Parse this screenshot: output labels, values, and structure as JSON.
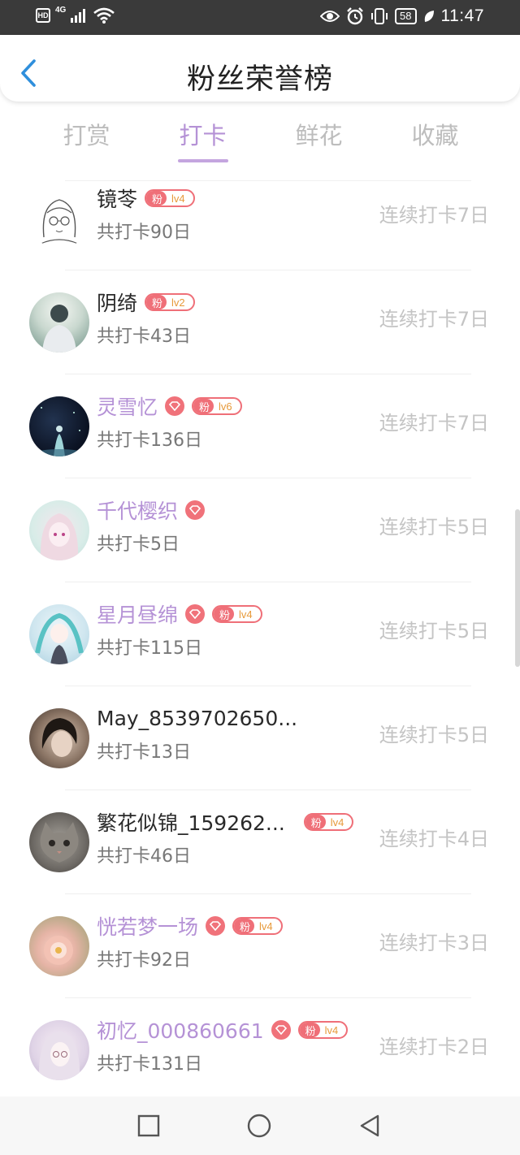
{
  "status_bar": {
    "hd_label": "HD",
    "network": "4G",
    "battery": "58",
    "time": "11:47",
    "icons": [
      "signal-icon",
      "wifi-icon",
      "eye-icon",
      "alarm-icon",
      "vibrate-icon",
      "battery-icon",
      "leaf-icon"
    ]
  },
  "header": {
    "title": "粉丝荣誉榜",
    "back_icon": "chevron-left-icon"
  },
  "tabs": [
    {
      "label": "打赏",
      "active": false
    },
    {
      "label": "打卡",
      "active": true
    },
    {
      "label": "鲜花",
      "active": false
    },
    {
      "label": "收藏",
      "active": false
    }
  ],
  "colors": {
    "accent": "#b592d6",
    "badge": "#ef6f78",
    "level_text": "#e79a3a",
    "muted": "#c4c4c4"
  },
  "fan_badge_label": "粉",
  "entries": [
    {
      "name": "镜苓",
      "vip": false,
      "gem": false,
      "level": "lv4",
      "total": "共打卡90日",
      "streak": "连续打卡7日"
    },
    {
      "name": "阴绮",
      "vip": false,
      "gem": false,
      "level": "lv2",
      "total": "共打卡43日",
      "streak": "连续打卡7日"
    },
    {
      "name": "灵雪忆",
      "vip": true,
      "gem": true,
      "level": "lv6",
      "total": "共打卡136日",
      "streak": "连续打卡7日"
    },
    {
      "name": "千代樱织",
      "vip": true,
      "gem": true,
      "level": null,
      "total": "共打卡5日",
      "streak": "连续打卡5日"
    },
    {
      "name": "星月昼绵",
      "vip": true,
      "gem": true,
      "level": "lv4",
      "total": "共打卡115日",
      "streak": "连续打卡5日"
    },
    {
      "name": "May_8539702650...",
      "vip": false,
      "gem": false,
      "level": null,
      "total": "共打卡13日",
      "streak": "连续打卡5日"
    },
    {
      "name": "繁花似锦_159262...",
      "vip": false,
      "gem": false,
      "level": "lv4",
      "total": "共打卡46日",
      "streak": "连续打卡4日"
    },
    {
      "name": "恍若梦一场",
      "vip": true,
      "gem": true,
      "level": "lv4",
      "total": "共打卡92日",
      "streak": "连续打卡3日"
    },
    {
      "name": "初忆_000860661",
      "vip": true,
      "gem": true,
      "level": "lv4",
      "total": "共打卡131日",
      "streak": "连续打卡2日"
    }
  ],
  "nav_bar": {
    "buttons": [
      "square-icon",
      "circle-icon",
      "triangle-back-icon"
    ]
  }
}
